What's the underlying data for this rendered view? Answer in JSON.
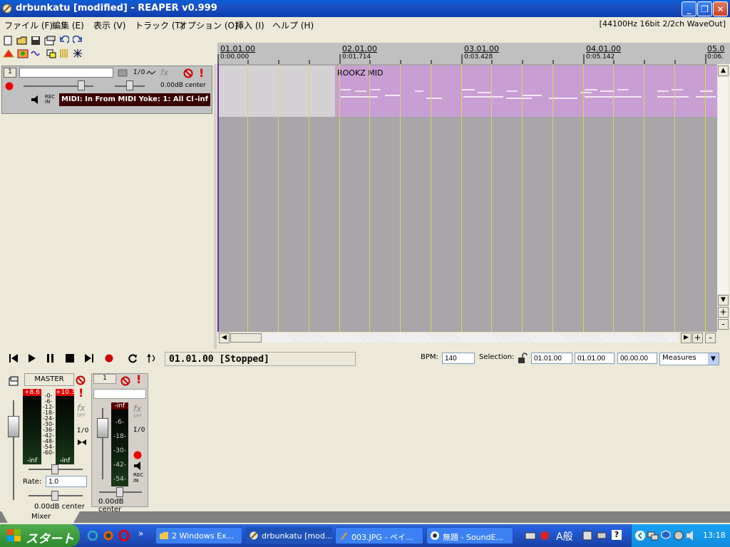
{
  "window": {
    "title": "drbunkatu [modified] - REAPER v0.999",
    "min_icon": "minimize-icon",
    "max_icon": "restore-icon",
    "close_icon": "close-icon"
  },
  "menu": {
    "items": [
      "ファイル (F)",
      "編集 (E)",
      "表示 (V)",
      "トラック (T)",
      "オプション (O)",
      "挿入 (I)",
      "ヘルプ (H)"
    ],
    "audio_status": "[44100Hz 16bit 2/2ch WaveOut]"
  },
  "ruler": {
    "marks": [
      {
        "bar": "01.01.00",
        "time": "0:00.000"
      },
      {
        "bar": "02.01.00",
        "time": "0:01.714"
      },
      {
        "bar": "03.01.00",
        "time": "0:03.428"
      },
      {
        "bar": "04.01.00",
        "time": "0:05.142"
      },
      {
        "bar": "05.0",
        "time": "0:06."
      }
    ]
  },
  "track": {
    "number": "1",
    "name": "",
    "io_label": "I/O",
    "fx_label": "fx",
    "volume_text": "0.00dB center",
    "rec_label": "REC",
    "in_label": "IN",
    "input_text": "MIDI: In From MIDI Yoke:  1: All Cl",
    "input_level": "-inf"
  },
  "item": {
    "name": "ROOKZ MID"
  },
  "transport": {
    "position": "01.01.00 [Stopped]",
    "bpm_label": "BPM:",
    "bpm_value": "140",
    "selection_label": "Selection:",
    "sel_start": "01.01.00",
    "sel_end": "01.01.00",
    "sel_len": "00.00.00",
    "mode": "Measures"
  },
  "mixer": {
    "master_label": "MASTER",
    "master_peak_l": "+8.6",
    "master_peak_r": "+10.3",
    "master_scale": [
      "-0-",
      "-6-",
      "-12-",
      "-18-",
      "-24-",
      "-30-",
      "-36-",
      "-42-",
      "-48-",
      "-54-",
      "-60-"
    ],
    "master_inf_l": "-inf",
    "master_inf_r": "-inf",
    "master_fx": "fx",
    "master_fx_off": "OFF",
    "master_io": "I/O",
    "rate_label": "Rate:",
    "rate_value": "1.0",
    "master_vol": "0.00dB center",
    "ch1_number": "1",
    "ch1_peak": "-inf",
    "ch1_scale": [
      "-6-",
      "-18-",
      "-30-",
      "-42-",
      "-54-"
    ],
    "ch1_fx": "fx",
    "ch1_fx_off": "OFF",
    "ch1_io": "I/O",
    "ch1_rec": "REC",
    "ch1_in": "IN",
    "ch1_vol": "0.00dB center",
    "tab_label": "Mixer"
  },
  "taskbar": {
    "start": "スタート",
    "tasks": [
      {
        "label": "2 Windows Ex..."
      },
      {
        "label": "drbunkatu [mod..."
      },
      {
        "label": "003.JPG - ペイ..."
      },
      {
        "label": "無題 - SoundE..."
      }
    ],
    "ime": "A般",
    "clock": "13:18"
  },
  "colors": {
    "item_bg": "#c89fd3",
    "arrange_bg": "#a8a6a8",
    "grid_line": "#d8d270",
    "xp_blue": "#245edb"
  }
}
